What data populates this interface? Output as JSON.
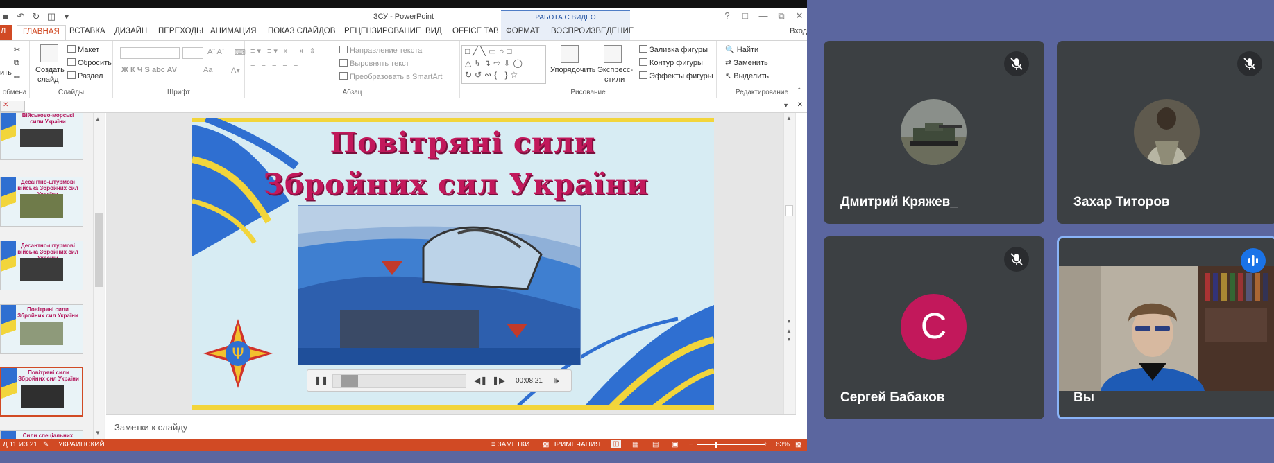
{
  "powerpoint": {
    "window_title": "ЗСУ - PowerPoint",
    "context_group": "РАБОТА С ВИДЕО",
    "sign_in": "Вход",
    "tabs": {
      "file": "Л",
      "home": "ГЛАВНАЯ",
      "insert": "ВСТАВКА",
      "design": "ДИЗАЙН",
      "transitions": "ПЕРЕХОДЫ",
      "animation": "АНИМАЦИЯ",
      "slideshow": "ПОКАЗ СЛАЙДОВ",
      "review": "РЕЦЕНЗИРОВАНИЕ",
      "view": "ВИД",
      "officetab": "OFFICE TAB",
      "format": "ФОРМАТ",
      "playback": "ВОСПРОИЗВЕДЕНИЕ"
    },
    "ribbon": {
      "paste": "ить",
      "clipboard_group": "обмена",
      "new_slide_1": "Создать",
      "new_slide_2": "слайд",
      "layout": "Макет",
      "reset": "Сбросить",
      "section": "Раздел",
      "slides_group": "Слайды",
      "font_group": "Шрифт",
      "font_buttons": "Ж  К  Ч  S  abc  AV",
      "font_size_buttons": "Aa",
      "text_direction": "Направление текста",
      "align_text": "Выровнять текст",
      "smartart": "Преобразовать в SmartArt",
      "paragraph_group": "Абзац",
      "arrange": "Упорядочить",
      "quick_styles_1": "Экспресс-",
      "quick_styles_2": "стили",
      "shape_fill": "Заливка фигуры",
      "shape_outline": "Контур фигуры",
      "shape_effects": "Эффекты фигуры",
      "drawing_group": "Рисование",
      "find": "Найти",
      "replace": "Заменить",
      "select": "Выделить",
      "editing_group": "Редактирование"
    },
    "thumbnails": [
      {
        "title": "Військово-морські сили України"
      },
      {
        "title": "Десантно-штурмові війська Збройних сил України"
      },
      {
        "title": "Десантно-штурмові війська Збройних сил України"
      },
      {
        "title": "Повітряні сили Збройних сил України"
      },
      {
        "title": "Повітряні сили Збройних сил України"
      },
      {
        "title": "Сили спеціальних операцій"
      }
    ],
    "slide": {
      "title_line1": "Повітряні сили",
      "title_line2": "Збройних сил України"
    },
    "video_controls": {
      "time": "00:08,21",
      "progress_fraction": 0.07
    },
    "notes_placeholder": "Заметки к слайду",
    "status": {
      "slide_counter": "Д 11 ИЗ 21",
      "language": "УКРАИНСКИЙ",
      "notes": "ЗАМЕТКИ",
      "comments": "ПРИМЕЧАНИЯ",
      "zoom": "63%"
    }
  },
  "meet": {
    "participants": [
      {
        "name": "Дмитрий Кряжев_",
        "muted": true
      },
      {
        "name": "Захар Титоров",
        "muted": true
      },
      {
        "name": "Сергей Бабаков",
        "muted": true,
        "initial": "C"
      },
      {
        "name": "Вы",
        "muted": false
      }
    ]
  },
  "colors": {
    "office_accent": "#d14a24",
    "meet_bg": "#5b669f",
    "tile_bg": "#3c4043",
    "active_speaker_border": "#8ab4f8",
    "avatar_c": "#c2185b",
    "slide_title": "#c2185b"
  }
}
